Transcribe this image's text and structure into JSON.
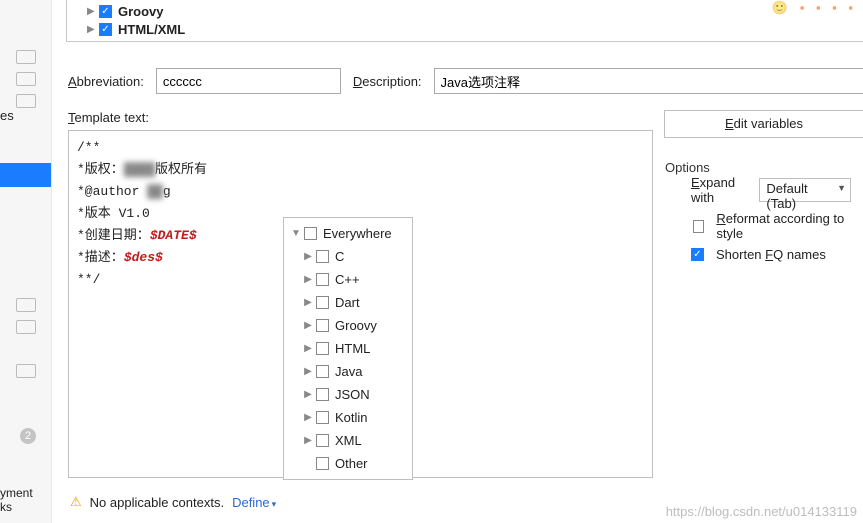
{
  "tree": {
    "items": [
      {
        "label": "Groovy",
        "checked": true
      },
      {
        "label": "HTML/XML",
        "checked": true
      }
    ]
  },
  "sidebar_fragment": {
    "letter": "es",
    "bottom1": "yment",
    "bottom2": "ks",
    "badge": "2"
  },
  "form": {
    "abbreviation_label": "Abbreviation:",
    "abbreviation_value": "cccccc",
    "description_label": "Description:",
    "description_value": "Java选项注释",
    "template_label": "Template text:"
  },
  "template_text": {
    "l1": "/**",
    "l2a": "*版权：",
    "l2b": "版权所有",
    "l3a": "*@author ",
    "l3b": "g",
    "l4": "*版本 V1.0",
    "l5a": "*创建日期：",
    "l5v": "$DATE$",
    "l6a": "*描述：",
    "l6v": "$des$",
    "l7": "**/"
  },
  "context_popup": {
    "items": [
      {
        "label": "Everywhere",
        "arrow": "down",
        "indent": 0
      },
      {
        "label": "C",
        "arrow": "right",
        "indent": 1
      },
      {
        "label": "C++",
        "arrow": "right",
        "indent": 1
      },
      {
        "label": "Dart",
        "arrow": "right",
        "indent": 1
      },
      {
        "label": "Groovy",
        "arrow": "right",
        "indent": 1
      },
      {
        "label": "HTML",
        "arrow": "right",
        "indent": 1
      },
      {
        "label": "Java",
        "arrow": "right",
        "indent": 1
      },
      {
        "label": "JSON",
        "arrow": "right",
        "indent": 1
      },
      {
        "label": "Kotlin",
        "arrow": "right",
        "indent": 1
      },
      {
        "label": "XML",
        "arrow": "right",
        "indent": 1
      },
      {
        "label": "Other",
        "arrow": "",
        "indent": 1
      }
    ]
  },
  "footer": {
    "warning_text": "No applicable contexts.",
    "define_text": "Define"
  },
  "right": {
    "edit_variables": "Edit variables",
    "options_title": "Options",
    "expand_label": "Expand with",
    "expand_value": "Default (Tab)",
    "reformat_label": "Reformat according to style",
    "shorten_label": "Shorten FQ names"
  },
  "watermark": "https://blog.csdn.net/u014133119"
}
